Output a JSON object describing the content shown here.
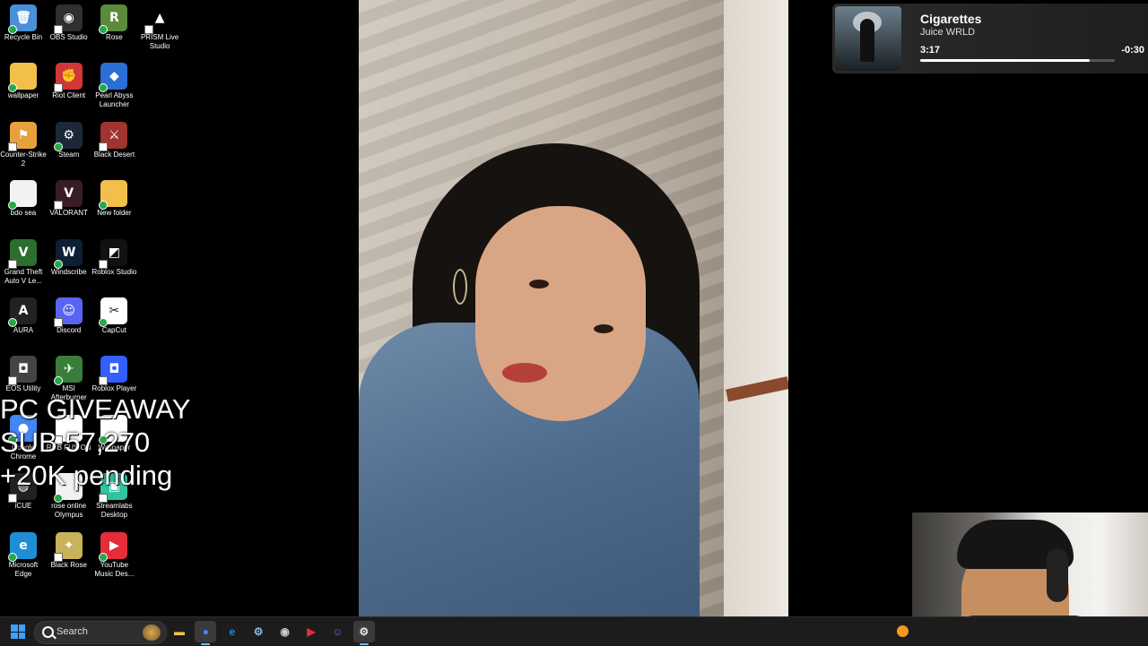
{
  "desktop": {
    "icons": [
      {
        "label": "Recycle Bin",
        "icon": "recycle-bin-icon",
        "color": "#4a90d9",
        "glyph": "🗑"
      },
      {
        "label": "OBS Studio",
        "icon": "obs-icon",
        "color": "#302e31",
        "glyph": "◉"
      },
      {
        "label": "Rose",
        "icon": "rose-game-icon",
        "color": "#5b8a3b",
        "glyph": "R"
      },
      {
        "label": "PRISM Live Studio",
        "icon": "prism-icon",
        "color": "#000000",
        "glyph": "▲"
      },
      {
        "label": "wallpaper",
        "icon": "folder-icon",
        "color": "#f2c04a",
        "glyph": ""
      },
      {
        "label": "Riot Client",
        "icon": "riot-client-icon",
        "color": "#d13639",
        "glyph": "✊"
      },
      {
        "label": "Pearl Abyss Launcher",
        "icon": "pearl-abyss-icon",
        "color": "#2b6ed4",
        "glyph": "◆"
      },
      {
        "label": "Counter-Strike 2",
        "icon": "cs2-icon",
        "color": "#e8a13a",
        "glyph": "⚑"
      },
      {
        "label": "Steam",
        "icon": "steam-icon",
        "color": "#1b2838",
        "glyph": "⚙"
      },
      {
        "label": "Black Desert",
        "icon": "black-desert-icon",
        "color": "#a0342e",
        "glyph": "⚔"
      },
      {
        "label": "bdo sea",
        "icon": "text-file-icon",
        "color": "#f2f2f2",
        "glyph": ""
      },
      {
        "label": "VALORANT",
        "icon": "valorant-icon",
        "color": "#3a1d24",
        "glyph": "V"
      },
      {
        "label": "New folder",
        "icon": "folder-icon",
        "color": "#f2c04a",
        "glyph": ""
      },
      {
        "label": "Grand Theft Auto V Le...",
        "icon": "gta-icon",
        "color": "#2c6e2e",
        "glyph": "V"
      },
      {
        "label": "Windscribe",
        "icon": "windscribe-icon",
        "color": "#0d1f33",
        "glyph": "W"
      },
      {
        "label": "Roblox Studio",
        "icon": "roblox-studio-icon",
        "color": "#111111",
        "glyph": "◩"
      },
      {
        "label": "AURA",
        "icon": "aura-icon",
        "color": "#222222",
        "glyph": "A"
      },
      {
        "label": "Discord",
        "icon": "discord-icon",
        "color": "#5865f2",
        "glyph": "☺"
      },
      {
        "label": "CapCut",
        "icon": "capcut-icon",
        "color": "#ffffff",
        "glyph": "✂"
      },
      {
        "label": "EOS Utility",
        "icon": "camera-icon",
        "color": "#444444",
        "glyph": "◘"
      },
      {
        "label": "MSI Afterburner",
        "icon": "msi-icon",
        "color": "#3a7d3a",
        "glyph": "✈"
      },
      {
        "label": "Roblox Player",
        "icon": "roblox-icon",
        "color": "#335fff",
        "glyph": "◘"
      },
      {
        "label": "Google Chrome",
        "icon": "chrome-icon",
        "color": "#4285f4",
        "glyph": "●"
      },
      {
        "label": "RGB FUSION",
        "icon": "rgb-fusion-icon",
        "color": "#ffffff",
        "glyph": ""
      },
      {
        "label": "Wallpaper",
        "icon": "wallpaper-app-icon",
        "color": "#ffffff",
        "glyph": ""
      },
      {
        "label": "iCUE",
        "icon": "icue-icon",
        "color": "#222222",
        "glyph": "◍"
      },
      {
        "label": "rose online Olympus",
        "icon": "text-file-icon",
        "color": "#f2f2f2",
        "glyph": ""
      },
      {
        "label": "Streamlabs Desktop",
        "icon": "streamlabs-icon",
        "color": "#31c3a2",
        "glyph": "▣"
      },
      {
        "label": "Microsoft Edge",
        "icon": "edge-icon",
        "color": "#1e8ed4",
        "glyph": "e"
      },
      {
        "label": "Black Rose",
        "icon": "black-rose-icon",
        "color": "#c8b25a",
        "glyph": "✦"
      },
      {
        "label": "YouTube Music Des...",
        "icon": "youtube-music-icon",
        "color": "#e52d3a",
        "glyph": "▶"
      }
    ]
  },
  "giveaway": {
    "line1": "PC GIVEAWAY",
    "line2": "SUB 57,270",
    "line3": "+20K pending"
  },
  "media": {
    "title": "Cigarettes",
    "artist": "Juice WRLD",
    "elapsed": "3:17",
    "remaining": "-0:30",
    "progress_fraction": 0.87
  },
  "taskbar": {
    "search_placeholder": "Search",
    "apps": [
      {
        "name": "file-explorer",
        "icon": "folder-icon",
        "color": "#f2c04a",
        "glyph": "▬"
      },
      {
        "name": "chrome",
        "icon": "chrome-icon",
        "color": "#4285f4",
        "glyph": "●",
        "active": true
      },
      {
        "name": "edge",
        "icon": "edge-icon",
        "color": "#1e8ed4",
        "glyph": "e"
      },
      {
        "name": "steam",
        "icon": "steam-icon",
        "color": "#8fb4d8",
        "glyph": "⚙"
      },
      {
        "name": "obs",
        "icon": "obs-icon",
        "color": "#cccccc",
        "glyph": "◉"
      },
      {
        "name": "youtube-music",
        "icon": "youtube-music-icon",
        "color": "#e52d3a",
        "glyph": "▶"
      },
      {
        "name": "discord",
        "icon": "discord-icon",
        "color": "#5865f2",
        "glyph": "☺"
      },
      {
        "name": "streamlabs",
        "icon": "streamlabs-icon",
        "color": "#e8e8e8",
        "glyph": "⚙",
        "active": true
      }
    ]
  }
}
